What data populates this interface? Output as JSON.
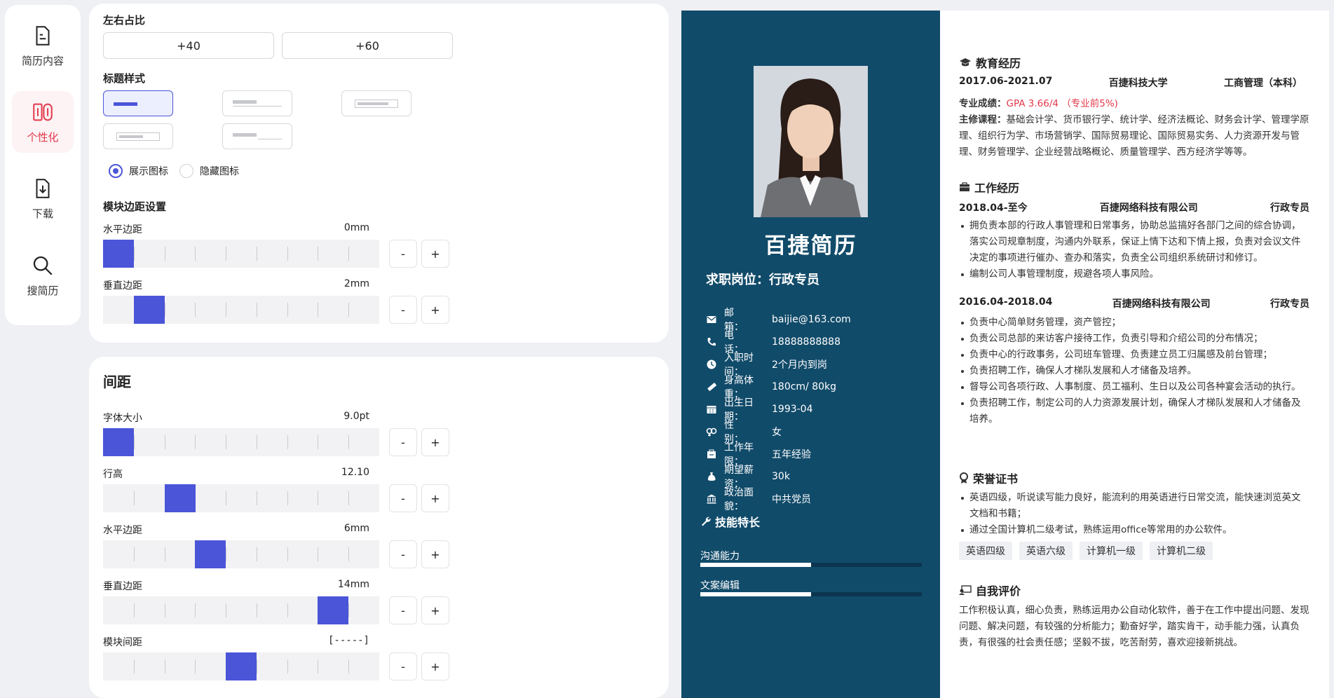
{
  "nav": {
    "items": [
      {
        "label": "简历内容",
        "icon": "document-icon"
      },
      {
        "label": "个性化",
        "icon": "personalize-icon"
      },
      {
        "label": "下载",
        "icon": "download-icon"
      },
      {
        "label": "搜简历",
        "icon": "search-icon"
      }
    ],
    "active_color": "#e2384b"
  },
  "layout_panel": {
    "ratio_label": "左右占比",
    "ratio_buttons": [
      "+40",
      "+60"
    ],
    "title_style_label": "标题样式",
    "icon_show": "展示图标",
    "icon_hide": "隐藏图标",
    "module_margin_label": "模块边距设置",
    "h_margin_label": "水平边距",
    "h_margin_value": "0mm",
    "v_margin_label": "垂直边距",
    "v_margin_value": "2mm",
    "minus": "-",
    "plus": "+"
  },
  "spacing_panel": {
    "title": "间距",
    "font_size_label": "字体大小",
    "font_size_value": "9.0pt",
    "line_height_label": "行高",
    "line_height_value": "12.10",
    "h_margin_label": "水平边距",
    "h_margin_value": "6mm",
    "v_margin_label": "垂直边距",
    "v_margin_value": "14mm",
    "module_gap_label": "模块间距",
    "module_gap_value": "[-----]",
    "minus": "-",
    "plus": "+"
  },
  "resume": {
    "name": "百捷简历",
    "job": "求职岗位：行政专员",
    "info": [
      {
        "key": "邮　　箱：",
        "value": "baijie@163.com",
        "icon": "mail-icon"
      },
      {
        "key": "电　　话：",
        "value": "18888888888",
        "icon": "phone-icon"
      },
      {
        "key": "入职时间：",
        "value": "2个月内到岗",
        "icon": "clock-icon"
      },
      {
        "key": "身高体重：",
        "value": "180cm/ 80kg",
        "icon": "ruler-icon"
      },
      {
        "key": "出生日期：",
        "value": "1993-04",
        "icon": "calendar-icon"
      },
      {
        "key": "性　　别：",
        "value": "女",
        "icon": "gender-icon"
      },
      {
        "key": "工作年限：",
        "value": "五年经验",
        "icon": "briefcase-date-icon"
      },
      {
        "key": "期望薪资：",
        "value": "30k",
        "icon": "money-bag-icon"
      },
      {
        "key": "政治面貌：",
        "value": "中共党员",
        "icon": "bank-icon"
      }
    ],
    "skills_title": "技能特长",
    "skills": [
      {
        "name": "沟通能力",
        "level": 0.5
      },
      {
        "name": "文案编辑",
        "level": 0.5
      }
    ],
    "edu_title": "教育经历",
    "edu": {
      "period": "2017.06-2021.07",
      "school": "百捷科技大学",
      "major": "工商管理（本科）",
      "gpa_label": "专业成绩：",
      "gpa_value": "GPA 3.66/4 （专业前5%)",
      "course_label": "主修课程：",
      "courses": "基础会计学、货币银行学、统计学、经济法概论、财务会计学、管理学原理、组织行为学、市场营销学、国际贸易理论、国际贸易实务、人力资源开发与管理、财务管理学、企业经营战略概论、质量管理学、西方经济学等等。"
    },
    "work_title": "工作经历",
    "work": [
      {
        "period": "2018.04-至今",
        "company": "百捷网络科技有限公司",
        "role": "行政专员",
        "items": [
          "拥负责本部的行政人事管理和日常事务，协助总监搞好各部门之间的综合协调，落实公司规章制度，沟通内外联系，保证上情下达和下情上报，负责对会议文件决定的事项进行催办、查办和落实，负责全公司组织系统研讨和修订。",
          "编制公司人事管理制度，规避各项人事风险。"
        ]
      },
      {
        "period": "2016.04-2018.04",
        "company": "百捷网络科技有限公司",
        "role": "行政专员",
        "items": [
          "负责中心简单财务管理，资产管控；",
          "负责公司总部的来访客户接待工作，负责引导和介绍公司的分布情况；",
          "负责中心的行政事务，公司班车管理、负责建立员工归属感及前台管理；",
          "负责招聘工作，确保人才梯队发展和人才储备及培养。",
          "督导公司各项行政、人事制度、员工福利、生日以及公司各种宴会活动的执行。",
          "负责招聘工作，制定公司的人力资源发展计划，确保人才梯队发展和人才储备及培养。"
        ]
      }
    ],
    "honor_title": "荣誉证书",
    "honor_items": [
      "英语四级，听说读写能力良好，能流利的用英语进行日常交流，能快速浏览英文文档和书籍；",
      "通过全国计算机二级考试，熟练运用office等常用的办公软件。"
    ],
    "tags": [
      "英语四级",
      "英语六级",
      "计算机一级",
      "计算机二级"
    ],
    "eval_title": "自我评价",
    "eval_text": "工作积极认真，细心负责，熟练运用办公自动化软件，善于在工作中提出问题、发现问题、解决问题，有较强的分析能力；勤奋好学，踏实肯干，动手能力强，认真负责，有很强的社会责任感；坚毅不拔，吃苦耐劳，喜欢迎接新挑战。",
    "sidebar_color": "#114b6a"
  }
}
